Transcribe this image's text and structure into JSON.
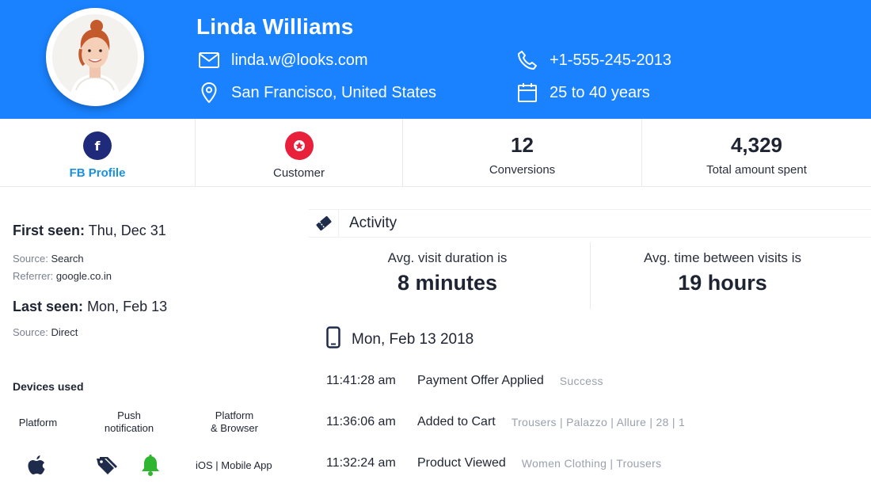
{
  "header": {
    "name": "Linda Williams",
    "email": "linda.w@looks.com",
    "phone": "+1-555-245-2013",
    "location": "San Francisco, United States",
    "age_range": "25 to 40 years",
    "icons": [
      "mail-icon",
      "phone-icon",
      "location-pin-icon",
      "calendar-icon"
    ],
    "background_color": "#1a82ff"
  },
  "stats": [
    {
      "icon": "facebook-icon",
      "label": "FB Profile",
      "color": "#1f2b7a"
    },
    {
      "icon": "star-icon",
      "label": "Customer",
      "color": "#e8203b"
    },
    {
      "value": "12",
      "label": "Conversions"
    },
    {
      "value": "4,329",
      "label": "Total amount spent"
    }
  ],
  "first_seen": {
    "label": "First seen:",
    "value": "Thu, Dec 31",
    "source_label": "Source:",
    "source": "Search",
    "referrer_label": "Referrer:",
    "referrer": "google.co.in"
  },
  "last_seen": {
    "label": "Last seen:",
    "value": "Mon, Feb 13",
    "source_label": "Source:",
    "source": "Direct"
  },
  "devices": {
    "title": "Devices used",
    "headers": [
      "Platform",
      "Push\nnotification",
      "Platform\n& Browser"
    ],
    "push_line1": "Push",
    "push_line2": "notification",
    "pb_line1": "Platform",
    "pb_line2": "& Browser",
    "platform_icon": "apple-icon",
    "push_icons": [
      "tags-icon",
      "bell-icon"
    ],
    "platform_browser": "iOS | Mobile App"
  },
  "activity": {
    "title": "Activity",
    "avg_visit_caption": "Avg. visit duration is",
    "avg_visit_value": "8 minutes",
    "avg_between_caption": "Avg. time between visits is",
    "avg_between_value": "19 hours",
    "date": "Mon, Feb 13 2018",
    "events": [
      {
        "time": "11:41:28 am",
        "name": "Payment Offer Applied",
        "detail": "Success"
      },
      {
        "time": "11:36:06 am",
        "name": "Added to Cart",
        "detail": "Trousers | Palazzo | Allure | 28 | 1"
      },
      {
        "time": "11:32:24 am",
        "name": "Product Viewed",
        "detail": "Women Clothing | Trousers"
      }
    ]
  }
}
